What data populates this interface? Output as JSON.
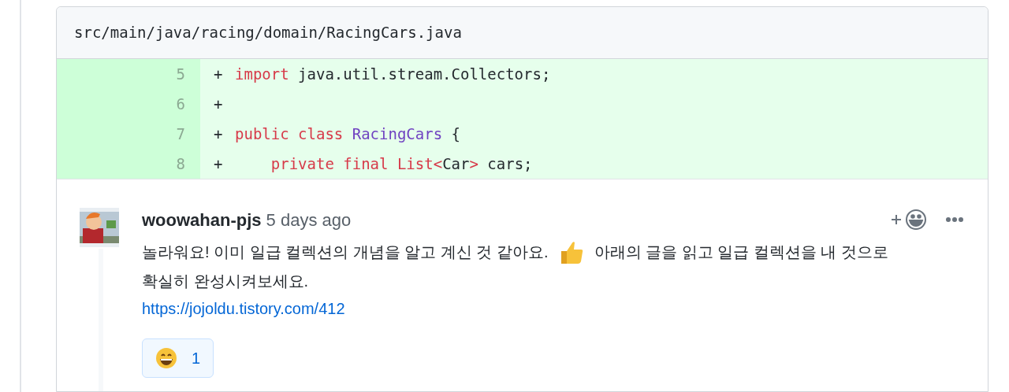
{
  "file": {
    "path": "src/main/java/racing/domain/RacingCars.java"
  },
  "diff_lines": [
    {
      "number": "5",
      "sign": "+",
      "tokens": [
        {
          "kind": "keyword",
          "text": "import"
        },
        {
          "kind": "plain",
          "text": " java.util.stream.Collectors;"
        }
      ]
    },
    {
      "number": "6",
      "sign": "+"
    },
    {
      "number": "7",
      "sign": "+",
      "tokens": [
        {
          "kind": "keyword",
          "text": "public"
        },
        {
          "kind": "keyword",
          "text": " class"
        },
        {
          "kind": "type",
          "text": " RacingCars"
        },
        {
          "kind": "plain",
          "text": " {"
        }
      ]
    },
    {
      "number": "8",
      "sign": "+",
      "tokens": [
        {
          "kind": "keyword",
          "text": "    private"
        },
        {
          "kind": "keyword",
          "text": " final"
        },
        {
          "kind": "keyword",
          "text": " List<"
        },
        {
          "kind": "plain",
          "text": "Car"
        },
        {
          "kind": "keyword",
          "text": ">"
        },
        {
          "kind": "plain",
          "text": " cars;"
        }
      ]
    }
  ],
  "comment": {
    "author": "woowahan-pjs",
    "time": "5 days ago",
    "body": [
      {
        "segments": [
          {
            "kind": "text",
            "text": "놀라워요! 이미 일급 컬렉션의 개념을 알고 계신 것 같아요."
          },
          {
            "kind": "emoji"
          },
          {
            "kind": "text",
            "text": "아래의 글을 읽고 일급 컬렉션을 내 것으로"
          }
        ]
      },
      {
        "segments": [
          {
            "kind": "text",
            "text": "확실히 완성시켜보세요."
          }
        ]
      }
    ],
    "link": "https://jojoldu.tistory.com/412",
    "reactions": [
      {
        "count": "1",
        "selected": true
      }
    ]
  }
}
